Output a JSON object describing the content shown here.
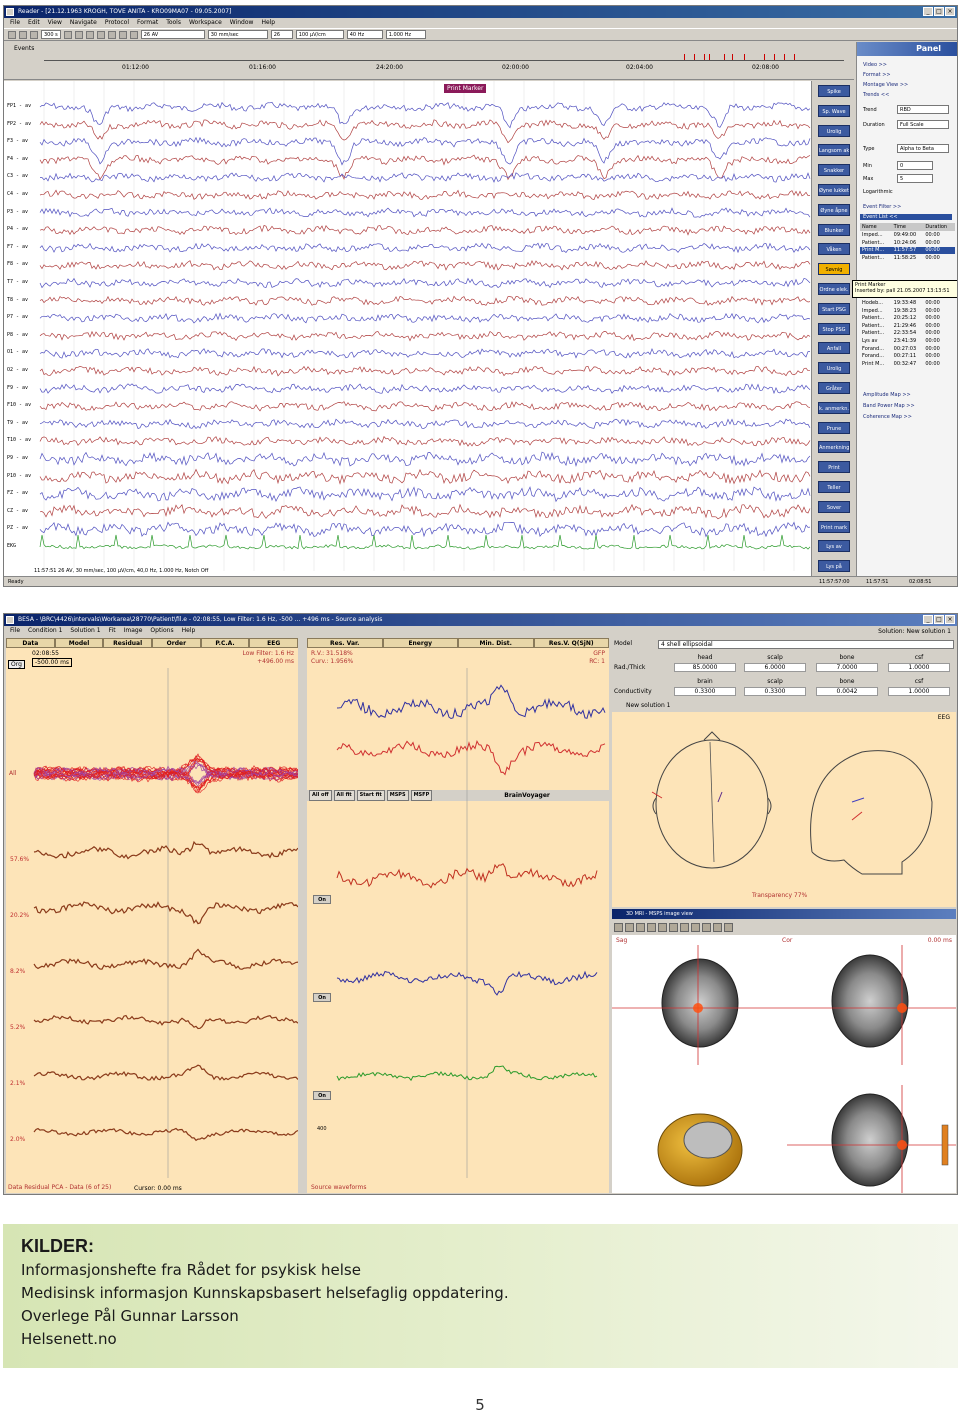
{
  "reader": {
    "title": "Reader - [21.12.1963 KROGH, TOVE ANITA - KRO09MA07 - 09.05.2007]",
    "menu": [
      "File",
      "Edit",
      "View",
      "Navigate",
      "Protocol",
      "Format",
      "Tools",
      "Workspace",
      "Window",
      "Help"
    ],
    "toolbar": {
      "speed": "300 s",
      "montage": "26 AV",
      "paper_speed": "30 mm/sec",
      "sens_count": "26",
      "sensitivity": "100 µV/cm",
      "filter_low": "40 Hz",
      "filter_high": "1.000 Hz"
    },
    "events_label": "Events",
    "timeline_ticks": [
      "01:12:00",
      "01:16:00",
      "24:20:00",
      "02:00:00",
      "02:04:00",
      "02:08:00"
    ],
    "print_marker": "Print Marker",
    "channels": [
      "FP1 - av",
      "FP2 - av",
      "F3 - av",
      "F4 - av",
      "C3 - av",
      "C4 - av",
      "P3 - av",
      "P4 - av",
      "F7 - av",
      "F8 - av",
      "T7 - av",
      "T8 - av",
      "P7 - av",
      "P8 - av",
      "O1 - av",
      "O2 - av",
      "F9 - av",
      "F10 - av",
      "T9 - av",
      "T10 - av",
      "P9 - av",
      "P10 - av",
      "FZ - av",
      "CZ - av",
      "PZ - av",
      "EKG"
    ],
    "eeg_status": "11:57:51 26 AV, 30 mm/sec, 100 µV/cm, 40,0 Hz, 1.000 Hz, Notch Off",
    "buttons": [
      "Spike",
      "Sp. Wave",
      "Urolig",
      "Langsom ak",
      "Snakker",
      "Øyne lukket",
      "Øyne åpne",
      "Blunker",
      "Våken",
      "Søvnig",
      "Ordne elek.",
      "Start PSG",
      "Stop PSG",
      "Anfall",
      "Urolig",
      "Gråter",
      "k. anmerkn.",
      "Prune",
      "Anmerkning",
      "Print",
      "Teller",
      "Sover",
      "Print mark",
      "Lys av",
      "Lys på"
    ],
    "selected_button_index": 9,
    "panel": {
      "title": "Panel",
      "items": [
        "Video >>",
        "Format >>",
        "Montage View >>",
        "Trends <<"
      ],
      "trend_label": "Trend",
      "trend_value": "RBD",
      "duration_label": "Duration",
      "duration_value": "Full Scale",
      "type_label": "Type",
      "type_value": "Alpha to Beta",
      "min_label": "Min",
      "min_value": "0",
      "max_label": "Max",
      "max_value": "5",
      "log_label": "Logarithmic",
      "event_filter": "Event Filter >>",
      "event_list": "Event List <<",
      "columns": [
        "Name",
        "Time",
        "Duration"
      ],
      "events": [
        [
          "Imped...",
          "09:49:00",
          "00:00"
        ],
        [
          "Patient...",
          "10:24:06",
          "00:00"
        ],
        [
          "Print M...",
          "11:57:57",
          "00:00"
        ],
        [
          "Patient...",
          "11:58:25",
          "00:00"
        ],
        [
          "Hodeb...",
          "19:33:48",
          "00:00"
        ],
        [
          "Imped...",
          "19:38:23",
          "00:00"
        ],
        [
          "Patient...",
          "20:25:12",
          "00:00"
        ],
        [
          "Patient...",
          "21:29:46",
          "00:00"
        ],
        [
          "Patient...",
          "22:33:54",
          "00:00"
        ],
        [
          "Lys av",
          "23:41:39",
          "00:00"
        ],
        [
          "Forand...",
          "00:27:03",
          "00:00"
        ],
        [
          "Forand...",
          "00:27:11",
          "00:00"
        ],
        [
          "Print M...",
          "00:32:47",
          "00:00"
        ]
      ],
      "selected_event_index": 2,
      "amplitude_map": "Amplitude Map >>",
      "band_power_map": "Band Power Map >>",
      "coherence_map": "Coherence Map >>"
    },
    "tooltip": {
      "title": "Print Marker",
      "body": "Inserted by: pall 21.05.2007 13:13:51"
    },
    "status": {
      "left": "Ready",
      "t1": "11:57:57:00",
      "t2": "11:57:51",
      "t3": "02:08:51"
    }
  },
  "besa": {
    "title": "BESA - \\BRC\\4426\\intervals\\Workarea\\28770\\Patient\\fil.e - 02:08:55, Low Filter: 1.6 Hz, -500 ... +496 ms - Source analysis",
    "menu": [
      "File",
      "Condition 1",
      "Solution 1",
      "Fit",
      "Image",
      "Options",
      "Help"
    ],
    "solution_label": "Solution: New solution 1",
    "tabs_left": [
      "Data",
      "Model",
      "Residual",
      "Order",
      "P.C.A.",
      "EEG"
    ],
    "tabs_mid": [
      "Res. Var.",
      "Energy",
      "Min. Dist.",
      "Res.V. Q(SjN)"
    ],
    "time_left": "02:08:55",
    "range_left": "-500.00 ms",
    "filter_text": "Low Filter: 1.6 Hz",
    "ms_text": "+496.00 ms",
    "rv_text": "R.V.: 31.518%",
    "curv_text": "Curv.: 1.956%",
    "gfp": "GFP",
    "rc": "RC: 1",
    "all_label": "All",
    "org_label": "Org",
    "pct_labels": [
      "57.6%",
      "20.2%",
      "8.2%",
      "5.2%",
      "2.1%",
      "2.0%"
    ],
    "mid_buttons": [
      "All off",
      "All fit",
      "Start fit",
      "MSPS",
      "MSFP"
    ],
    "brain_voyager": "BrainVoyager",
    "on_labels": [
      "On",
      "On",
      "On"
    ],
    "model": {
      "label": "Model",
      "value": "4 shell ellipsoidal",
      "rad_thick": "Rad./Thick",
      "conductivity": "Conductivity",
      "headers1": [
        "head",
        "scalp",
        "bone",
        "csf"
      ],
      "row1": [
        "85.0000",
        "6.0000",
        "7.0000",
        "1.0000"
      ],
      "headers2": [
        "brain",
        "scalp",
        "bone",
        "csf"
      ],
      "row2": [
        "0.3300",
        "0.3300",
        "0.0042",
        "1.0000"
      ]
    },
    "new_solution": "New solution 1",
    "eeg_label": "EEG",
    "transparency": "Transparency 77%",
    "mri_title": "3D MRI - MSPS image view",
    "sag": "Sag",
    "cor": "Cor",
    "ms_right": "0.00 ms",
    "bottom_left": "Data  Residual  PCA - Data  (6 of 25)",
    "cursor": "Cursor: 0.00 ms",
    "source_waveforms": "Source waveforms",
    "scale_400": "400"
  },
  "sources": {
    "heading": "KILDER:",
    "lines": [
      "Informasjonshefte fra Rådet for psykisk helse",
      "Medisinsk informasjon Kunnskapsbasert helsefaglig oppdatering.",
      "Overlege Pål Gunnar Larsson",
      "Helsenett.no"
    ]
  },
  "page_number": "5"
}
